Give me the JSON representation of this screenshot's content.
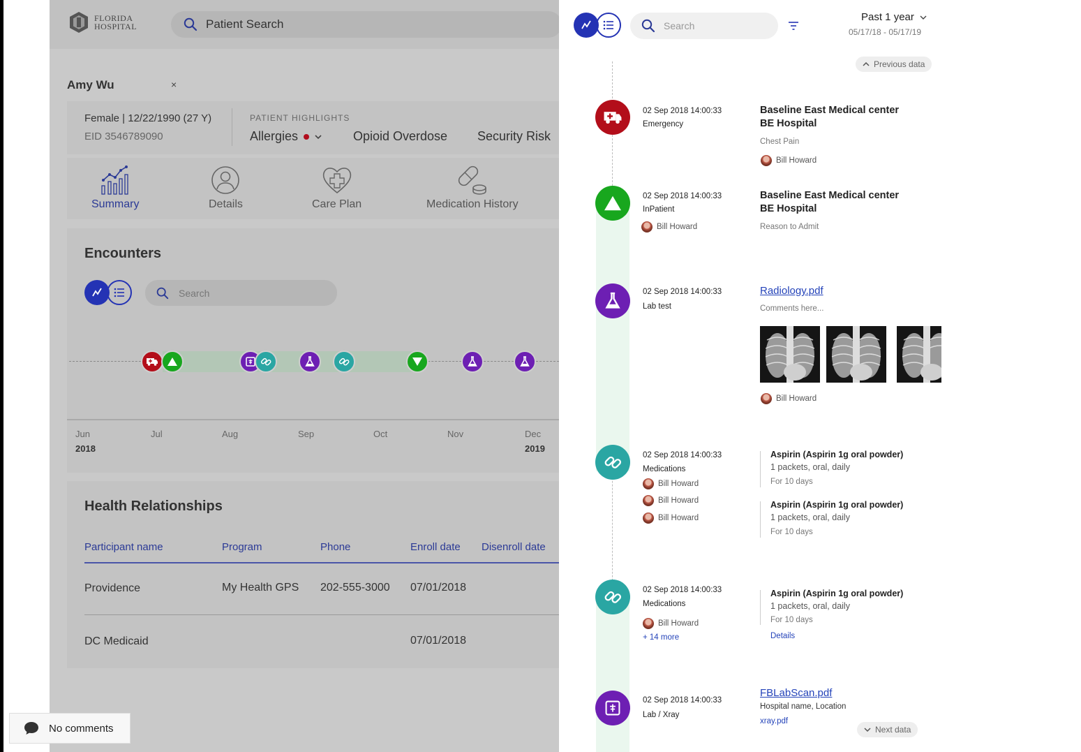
{
  "app": {
    "logo_line1": "FLORIDA",
    "logo_line2": "HOSPITAL",
    "patient_search_placeholder": "Patient Search"
  },
  "patient": {
    "tab_name": "Amy Wu",
    "tab_close": "×",
    "demographics": "Female | 12/22/1990 (27 Y)",
    "eid": "EID 3546789090",
    "highlights_label": "PATIENT HIGHLIGHTS",
    "highlights": [
      "Allergies",
      "Opioid Overdose",
      "Security Risk"
    ]
  },
  "nav": {
    "items": [
      {
        "label": "Summary",
        "icon": "chart-bars-icon",
        "active": true
      },
      {
        "label": "Details",
        "icon": "person-icon",
        "active": false
      },
      {
        "label": "Care Plan",
        "icon": "heart-plus-icon",
        "active": false
      },
      {
        "label": "Medication History",
        "icon": "pills-icon",
        "active": false
      }
    ]
  },
  "encounters": {
    "title": "Encounters",
    "search_placeholder": "Search",
    "months": [
      "Jun",
      "Jul",
      "Aug",
      "Sep",
      "Oct",
      "Nov",
      "Dec"
    ],
    "year_start": "2018",
    "year_end": "2019",
    "events": [
      {
        "type": "emergency",
        "color": "#b30e1a"
      },
      {
        "type": "inpatient-up",
        "color": "#18a71e"
      },
      {
        "type": "xray",
        "color": "#6d1fb3"
      },
      {
        "type": "medication",
        "color": "#2aa6a3"
      },
      {
        "type": "lab",
        "color": "#6d1fb3"
      },
      {
        "type": "medication",
        "color": "#2aa6a3"
      },
      {
        "type": "inpatient-down",
        "color": "#18a71e"
      },
      {
        "type": "lab",
        "color": "#6d1fb3"
      },
      {
        "type": "lab",
        "color": "#6d1fb3"
      }
    ]
  },
  "relationships": {
    "title": "Health Relationships",
    "columns": [
      "Participant name",
      "Program",
      "Phone",
      "Enroll date",
      "Disenroll date"
    ],
    "rows": [
      [
        "Providence",
        "My Health GPS",
        "202-555-3000",
        "07/01/2018",
        ""
      ],
      [
        "DC Medicaid",
        "",
        "",
        "07/01/2018",
        ""
      ]
    ]
  },
  "comments": {
    "label": "No comments"
  },
  "panel": {
    "search_placeholder": "Search",
    "period": "Past 1 year",
    "period_range": "05/17/18 - 05/17/19",
    "previous": "Previous data",
    "next": "Next data",
    "entries": [
      {
        "date": "02 Sep 2018 14:00:33",
        "type": "Emergency",
        "hospital": "Baseline East Medical center",
        "hospital2": "BE Hospital",
        "note": "Chest Pain",
        "author": "Bill Howard"
      },
      {
        "date": "02 Sep 2018 14:00:33",
        "type": "InPatient",
        "author": "Bill Howard",
        "hospital": "Baseline East Medical center",
        "hospital2": "BE Hospital",
        "note": "Reason to Admit"
      },
      {
        "date": "02 Sep 2018 14:00:33",
        "type": "Lab test",
        "file": "Radiology.pdf",
        "note": "Comments here...",
        "author": "Bill Howard"
      },
      {
        "date": "02 Sep 2018 14:00:33",
        "type": "Medications",
        "authors": [
          "Bill Howard",
          "Bill Howard",
          "Bill Howard"
        ],
        "meds": [
          {
            "name": "Aspirin (Aspirin 1g oral powder)",
            "sig": "1 packets, oral, daily",
            "dur": "For 10 days"
          },
          {
            "name": "Aspirin (Aspirin 1g oral powder)",
            "sig": "1 packets, oral, daily",
            "dur": "For 10 days"
          }
        ]
      },
      {
        "date": "02 Sep 2018 14:00:33",
        "type": "Medications",
        "author": "Bill Howard",
        "more": "+ 14 more",
        "med": {
          "name": "Aspirin (Aspirin 1g oral powder)",
          "sig": "1 packets, oral, daily",
          "dur": "For 10 days"
        },
        "details": "Details"
      },
      {
        "date": "02 Sep 2018 14:00:33",
        "type": "Lab / Xray",
        "file": "FBLabScan.pdf",
        "location": "Hospital name, Location",
        "attachment": "xray.pdf"
      }
    ]
  },
  "colors": {
    "primary": "#2433b4",
    "emergency": "#b30e1a",
    "inpatient": "#18a71e",
    "lab": "#6d1fb3",
    "medication": "#2aa6a3"
  }
}
